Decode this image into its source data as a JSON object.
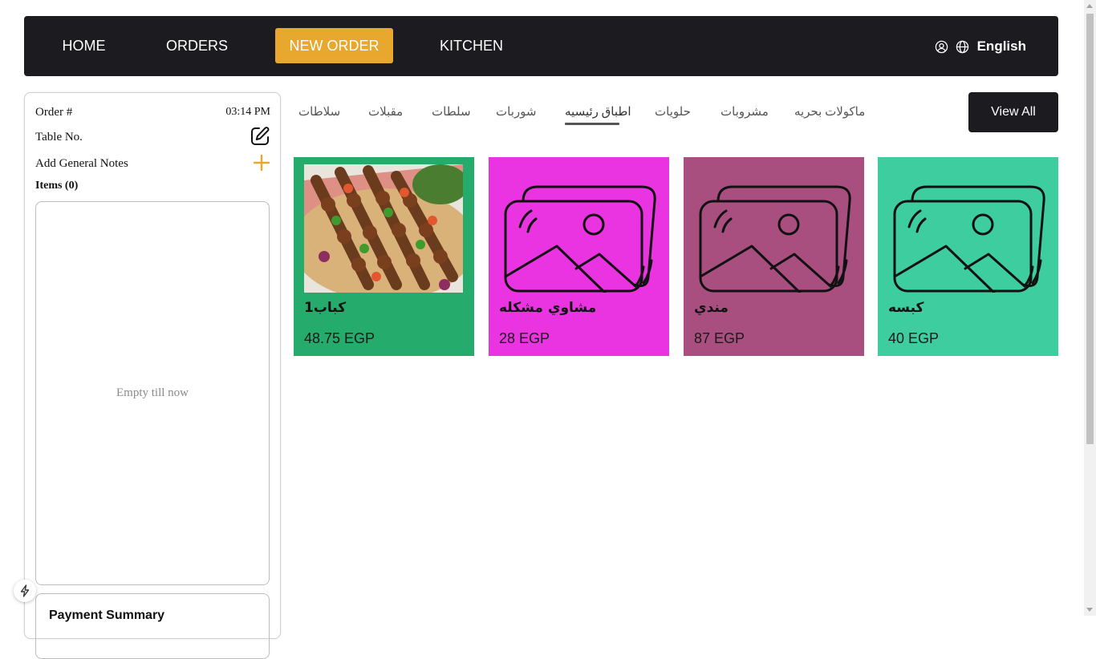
{
  "nav": {
    "home": "HOME",
    "orders": "ORDERS",
    "new_order": "NEW ORDER",
    "kitchen": "KITCHEN",
    "language": "English",
    "user_icon": "user-icon",
    "globe_icon": "globe-icon",
    "active_color": "#e8a82e"
  },
  "order": {
    "order_label": "Order #",
    "time": "03:14 PM",
    "table_label": "Table No.",
    "notes_label": "Add General Notes",
    "items_label": "Items (0)",
    "empty_text": "Empty till now",
    "payment_title": "Payment Summary"
  },
  "categories": [
    "سلاطات",
    "مقبلات",
    "سلطات",
    "شوربات",
    "اطباق رئيسيه",
    "حلويات",
    "مشروبات",
    "ماكولات بحريه"
  ],
  "active_category": "اطباق رئيسيه",
  "view_all": "View All",
  "products": [
    {
      "name": "كباب1",
      "price": "48.75 EGP",
      "color": "#25ab6b",
      "image": "photo"
    },
    {
      "name": "مشاوي مشكله",
      "price": "28 EGP",
      "color": "#eb34e1",
      "image": "placeholder"
    },
    {
      "name": "مندي",
      "price": "87 EGP",
      "color": "#a84f80",
      "image": "placeholder"
    },
    {
      "name": "كبسه",
      "price": "40 EGP",
      "color": "#3ecd9f",
      "image": "placeholder"
    }
  ]
}
